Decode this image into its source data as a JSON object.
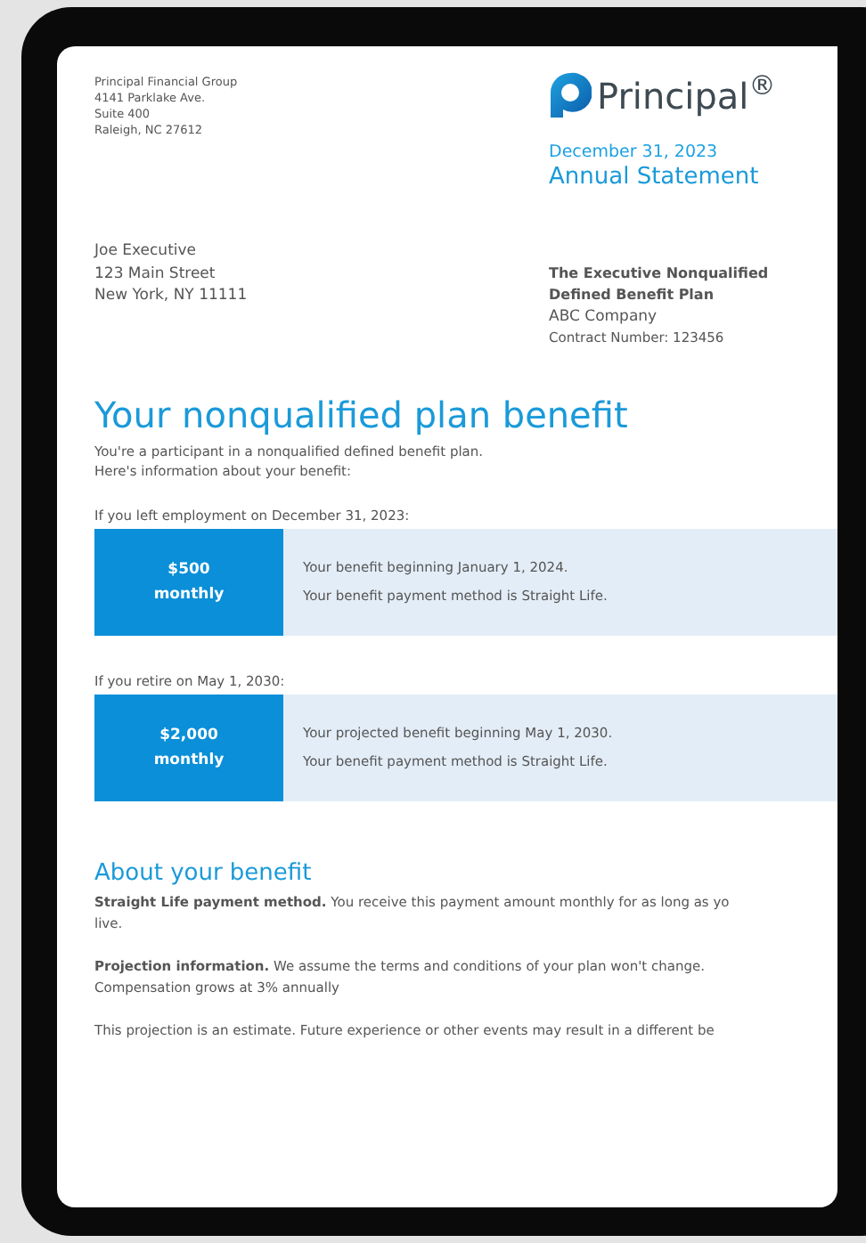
{
  "sender_address": [
    "Principal Financial Group",
    "4141 Parklake Ave.",
    "Suite 400",
    "Raleigh, NC 27612"
  ],
  "logo": {
    "wordmark": "Principal$^{®}$"
  },
  "statement_date": "December 31, 2023",
  "statement_title": "Annual Statement",
  "recipient_address": [
    "Joe Executive",
    "123 Main Street",
    "New York, NY 11111"
  ],
  "plan": {
    "name_lines": [
      "The Executive Nonqualified",
      "Defined Benefit Plan"
    ],
    "company": "ABC Company",
    "contract": "Contract Number: 123456"
  },
  "heading": "Your nonqualified plan benefit",
  "intro": [
    "You're a participant in a nonqualified defined benefit plan.",
    "Here's information about your benefit:"
  ],
  "scenarios": [
    {
      "label": "If you left employment on December 31, 2023:",
      "amount": "$500",
      "period": "monthly",
      "details": [
        "Your benefit beginning January 1, 2024.",
        "Your benefit payment method is Straight Life."
      ]
    },
    {
      "label": "If you retire on May 1, 2030:",
      "amount": "$2,000",
      "period": "monthly",
      "details": [
        "Your projected benefit beginning May 1, 2030.",
        "Your benefit payment method is Straight Life."
      ]
    }
  ],
  "about": {
    "title": "About your benefit",
    "paragraphs": [
      [
        "**Straight Life payment method.** You receive this payment amount monthly for as long as yo",
        "live."
      ],
      [
        "**Projection information.** We assume the terms and conditions of your plan won't change.",
        "Compensation grows at 3% annually"
      ],
      [
        "This projection is an estimate. Future experience or other events may result in a different be"
      ]
    ]
  }
}
